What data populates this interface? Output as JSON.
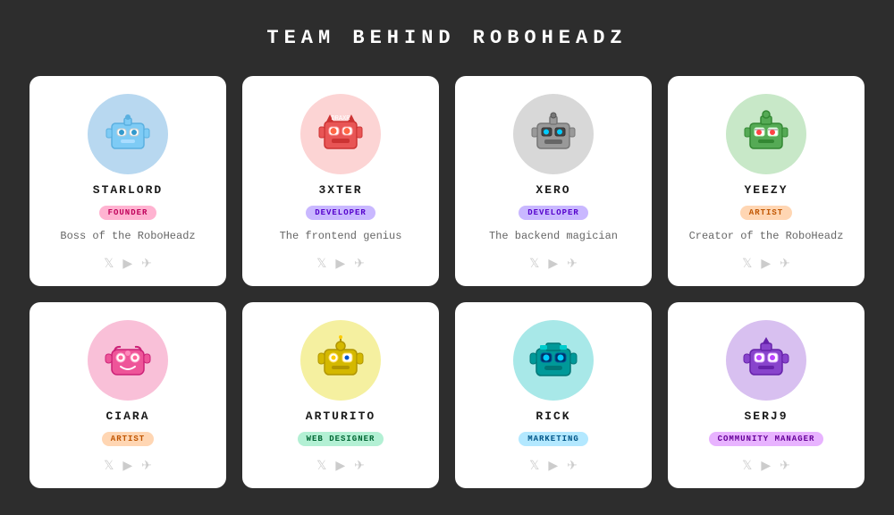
{
  "page": {
    "title": "TEAM  BEHIND  ROBOHEADZ"
  },
  "members": [
    {
      "id": "starlord",
      "name": "STARLORD",
      "role": "FOUNDER",
      "role_class": "role-founder",
      "description": "Boss of the RoboHeadz",
      "avatar_bg": "#b8d8f0",
      "emoji": "🤖",
      "robot_color": "#6eb5e0"
    },
    {
      "id": "3xter",
      "name": "3XTER",
      "role": "DEVELOPER",
      "role_class": "role-developer",
      "description": "The frontend genius",
      "avatar_bg": "#fcd4d4",
      "emoji": "🤖",
      "robot_color": "#e85555"
    },
    {
      "id": "xero",
      "name": "XERO",
      "role": "DEVELOPER",
      "role_class": "role-developer",
      "description": "The backend magician",
      "avatar_bg": "#d8d8d8",
      "emoji": "🤖",
      "robot_color": "#888888"
    },
    {
      "id": "yeezy",
      "name": "YEEZY",
      "role": "ARTIST",
      "role_class": "role-artist",
      "description": "Creator of the RoboHeadz",
      "avatar_bg": "#c8e8c8",
      "emoji": "🤖",
      "robot_color": "#55aa55"
    },
    {
      "id": "ciara",
      "name": "CIARA",
      "role": "ARTIST",
      "role_class": "role-artist",
      "description": "",
      "avatar_bg": "#f9c0d8",
      "emoji": "🤖",
      "robot_color": "#e85599"
    },
    {
      "id": "arturito",
      "name": "ARTURITO",
      "role": "WEB DESIGNER",
      "role_class": "role-web-designer",
      "description": "",
      "avatar_bg": "#f5f0a0",
      "emoji": "🤖",
      "robot_color": "#d4b800"
    },
    {
      "id": "rick",
      "name": "RICK",
      "role": "MARKETING",
      "role_class": "role-marketing",
      "description": "",
      "avatar_bg": "#a8e8e8",
      "emoji": "🤖",
      "robot_color": "#009999"
    },
    {
      "id": "serj9",
      "name": "SERJ9",
      "role": "COMMUNITY MANAGER",
      "role_class": "role-community",
      "description": "",
      "avatar_bg": "#d8c0f0",
      "emoji": "🤖",
      "robot_color": "#8844cc"
    }
  ],
  "social": {
    "icons": [
      "twitter",
      "youtube",
      "telegram"
    ]
  }
}
